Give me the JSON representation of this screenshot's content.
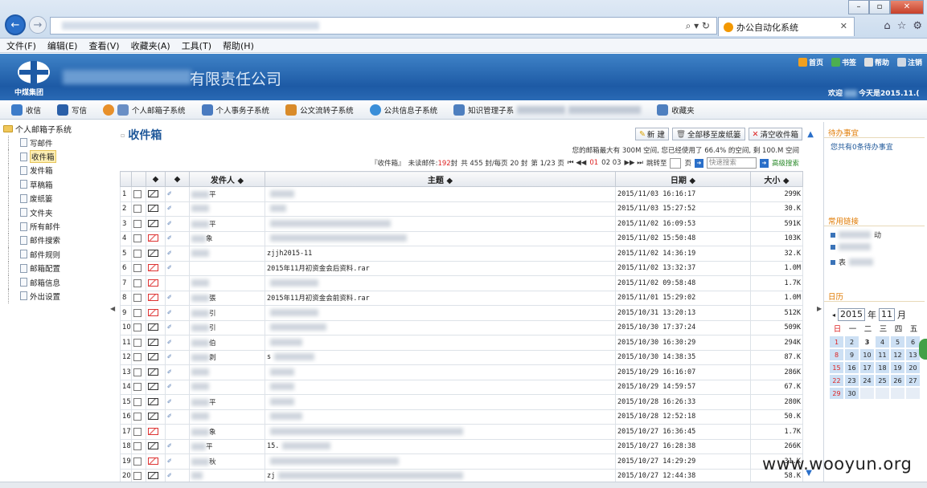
{
  "browser": {
    "tab_title": "办公自动化系统",
    "menu": [
      "文件(F)",
      "编辑(E)",
      "查看(V)",
      "收藏夹(A)",
      "工具(T)",
      "帮助(H)"
    ]
  },
  "header": {
    "logo_text": "中煤集团",
    "company_suffix": "有限责任公司",
    "links": [
      "首页",
      "书签",
      "帮助",
      "注销"
    ],
    "welcome_prefix": "欢迎",
    "welcome_suffix": "今天是2015.11.("
  },
  "modules": [
    "收信",
    "写信",
    "个人邮箱子系统",
    "个人事务子系统",
    "公文流转子系统",
    "公共信息子系统",
    "知识管理子系",
    "收藏夹"
  ],
  "sidebar": {
    "root": "个人邮箱子系统",
    "items": [
      "写邮件",
      "收件箱",
      "发件箱",
      "草稿箱",
      "废纸篓",
      "文件夹",
      "所有邮件",
      "邮件搜索",
      "邮件规则",
      "邮箱配置",
      "邮箱信息",
      "外出设置"
    ]
  },
  "main": {
    "title": "收件箱",
    "actions": [
      "新 建",
      "全部移至废纸篓",
      "清空收件箱"
    ],
    "quota": "您的邮箱最大有 300M 空间, 您已经使用了 66.4% 的空间, 剩 100.M 空间",
    "pager": {
      "folder": "『收件箱』",
      "unread_label": "未读邮件:",
      "unread": "192",
      "unread_unit": "封",
      "total": "共 455 封/每页 20 封",
      "page": "第 1/23 页",
      "nav_first": "⏮ ◀◀",
      "page_current": "01",
      "page_others": "02 03",
      "nav_last": "▶▶ ⏭",
      "jump_label": "跳转至",
      "page_unit": "页",
      "quick_search": "快速搜索",
      "advanced": "高级搜索"
    },
    "columns": [
      "",
      "",
      "◆",
      "◆",
      "发件人 ◆",
      "主题 ◆",
      "日期 ◆",
      "大小 ◆"
    ],
    "rows": [
      {
        "n": "1",
        "read": true,
        "clip": true,
        "sender": "平",
        "subject": "",
        "date": "2015/11/03 16:16:17",
        "size": "299K"
      },
      {
        "n": "2",
        "read": true,
        "clip": true,
        "sender": "",
        "subject": "",
        "date": "2015/11/03 15:27:52",
        "size": "30.K"
      },
      {
        "n": "3",
        "read": true,
        "clip": true,
        "sender": "平",
        "subject": "",
        "date": "2015/11/02 16:09:53",
        "size": "591K"
      },
      {
        "n": "4",
        "read": false,
        "clip": true,
        "sender": "象",
        "subject": "",
        "date": "2015/11/02 15:50:48",
        "size": "103K"
      },
      {
        "n": "5",
        "read": true,
        "clip": true,
        "sender": "",
        "subject": "zjjh2015-11",
        "date": "2015/11/02 14:36:19",
        "size": "32.K"
      },
      {
        "n": "6",
        "read": false,
        "clip": true,
        "sender": "",
        "subject": "2015年11月初资金会后资料.rar",
        "date": "2015/11/02 13:32:37",
        "size": "1.0M"
      },
      {
        "n": "7",
        "read": false,
        "clip": false,
        "sender": "",
        "subject": "",
        "date": "2015/11/02 09:58:48",
        "size": "1.7K"
      },
      {
        "n": "8",
        "read": false,
        "clip": true,
        "sender": "張",
        "subject": "2015年11月初资金会前资料.rar",
        "date": "2015/11/01 15:29:02",
        "size": "1.0M"
      },
      {
        "n": "9",
        "read": false,
        "clip": true,
        "sender": "引",
        "subject": "",
        "date": "2015/10/31 13:20:13",
        "size": "512K"
      },
      {
        "n": "10",
        "read": true,
        "clip": true,
        "sender": "引",
        "subject": "",
        "date": "2015/10/30 17:37:24",
        "size": "509K"
      },
      {
        "n": "11",
        "read": true,
        "clip": true,
        "sender": "伯",
        "subject": "",
        "date": "2015/10/30 16:30:29",
        "size": "294K"
      },
      {
        "n": "12",
        "read": true,
        "clip": true,
        "sender": "剥",
        "subject": "s",
        "date": "2015/10/30 14:38:35",
        "size": "87.K"
      },
      {
        "n": "13",
        "read": true,
        "clip": true,
        "sender": "",
        "subject": "",
        "date": "2015/10/29 16:16:07",
        "size": "286K"
      },
      {
        "n": "14",
        "read": true,
        "clip": true,
        "sender": "",
        "subject": "",
        "date": "2015/10/29 14:59:57",
        "size": "67.K"
      },
      {
        "n": "15",
        "read": true,
        "clip": true,
        "sender": "平",
        "subject": "",
        "date": "2015/10/28 16:26:33",
        "size": "280K"
      },
      {
        "n": "16",
        "read": true,
        "clip": true,
        "sender": "",
        "subject": "",
        "date": "2015/10/28 12:52:18",
        "size": "50.K"
      },
      {
        "n": "17",
        "read": false,
        "clip": false,
        "sender": "象",
        "subject": "",
        "date": "2015/10/27 16:36:45",
        "size": "1.7K"
      },
      {
        "n": "18",
        "read": true,
        "clip": true,
        "sender": "平",
        "subject": "15.",
        "date": "2015/10/27 16:28:38",
        "size": "266K"
      },
      {
        "n": "19",
        "read": false,
        "clip": true,
        "sender": "秋",
        "subject": "",
        "date": "2015/10/27 14:29:29",
        "size": "31.K"
      },
      {
        "n": "20",
        "read": true,
        "clip": true,
        "sender": "",
        "subject": "zj",
        "date": "2015/10/27 12:44:38",
        "size": "58.K"
      }
    ]
  },
  "right_panel": {
    "todo_title": "待办事宜",
    "todo_text": "您共有0条待办事宜",
    "links_title": "常用链接",
    "links": [
      "动",
      "",
      "表"
    ],
    "calendar_title": "日历",
    "cal_year": "2015",
    "cal_year_label": "年",
    "cal_month": "11",
    "cal_month_label": "月",
    "weekdays": [
      "日",
      "一",
      "二",
      "三",
      "四",
      "五"
    ],
    "days": [
      "1",
      "2",
      "3",
      "4",
      "5",
      "6",
      "8",
      "9",
      "10",
      "11",
      "12",
      "13",
      "15",
      "16",
      "17",
      "18",
      "19",
      "20",
      "22",
      "23",
      "24",
      "25",
      "26",
      "27",
      "29",
      "30"
    ]
  },
  "watermark": "www.wooyun.org"
}
